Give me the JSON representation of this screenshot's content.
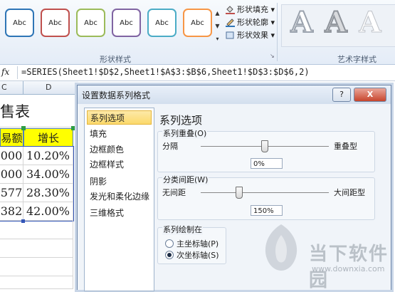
{
  "ribbon": {
    "shape_styles": [
      {
        "label": "Abc",
        "color": "#2e75b6"
      },
      {
        "label": "Abc",
        "color": "#c0504d"
      },
      {
        "label": "Abc",
        "color": "#9bbb59"
      },
      {
        "label": "Abc",
        "color": "#8064a2"
      },
      {
        "label": "Abc",
        "color": "#4bacc6"
      },
      {
        "label": "Abc",
        "color": "#f79646"
      }
    ],
    "shape_fill_label": "形状填充",
    "shape_outline_label": "形状轮廓",
    "shape_effects_label": "形状效果",
    "group_shape_styles": "形状样式",
    "group_wordart_styles": "艺术字样式",
    "wordart_letter": "A"
  },
  "formula_bar": {
    "fx_label": "fx",
    "formula": "=SERIES(Sheet1!$D$2,Sheet1!$A$3:$B$6,Sheet1!$D$3:$D$6,2)"
  },
  "sheet": {
    "col_c": "C",
    "col_d": "D",
    "title_partial": "售表",
    "header_c": "易额",
    "header_d": "增长",
    "rows": [
      {
        "c": "000",
        "d": "10.20%"
      },
      {
        "c": "000",
        "d": "34.00%"
      },
      {
        "c": "577",
        "d": "28.30%"
      },
      {
        "c": "382",
        "d": "42.00%"
      }
    ]
  },
  "dialog": {
    "title": "设置数据系列格式",
    "help_label": "?",
    "close_label": "X",
    "nav": [
      "系列选项",
      "填充",
      "边框颜色",
      "边框样式",
      "阴影",
      "发光和柔化边缘",
      "三维格式"
    ],
    "selected_index": 0,
    "panel_title": "系列选项",
    "overlap": {
      "legend": "系列重叠(O)",
      "left": "分隔",
      "right": "重叠型",
      "value": "0%",
      "level": 0.5
    },
    "gap": {
      "legend": "分类间距(W)",
      "left": "无间距",
      "right": "大间距型",
      "value": "150%",
      "level": 0.3
    },
    "plot_on": {
      "legend": "系列绘制在",
      "primary": "主坐标轴(P)",
      "secondary": "次坐标轴(S)",
      "selected": "secondary"
    }
  },
  "watermark": {
    "name": "当下软件园",
    "url": "www.downxia.com"
  }
}
